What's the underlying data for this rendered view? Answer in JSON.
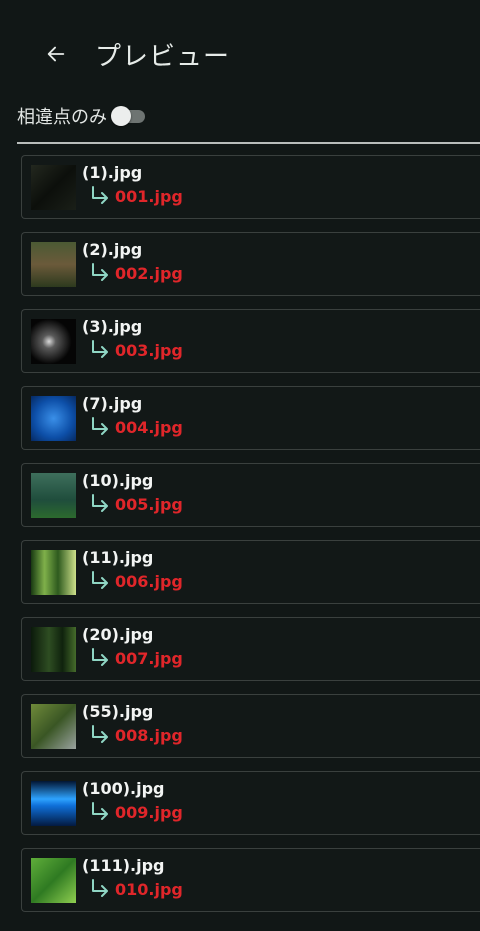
{
  "header": {
    "title": "プレビュー",
    "back_icon": "arrow-left-icon"
  },
  "filter": {
    "label": "相違点のみ",
    "enabled": false
  },
  "colors": {
    "background": "#111716",
    "renamed_text": "#e0262a",
    "arrow": "#8fd6c4"
  },
  "items": [
    {
      "original": "(1).jpg",
      "renamed": "001.jpg",
      "thumb": "dark-forest-photo"
    },
    {
      "original": "(2).jpg",
      "renamed": "002.jpg",
      "thumb": "forest-path-photo"
    },
    {
      "original": "(3).jpg",
      "renamed": "003.jpg",
      "thumb": "dark-flower-photo"
    },
    {
      "original": "(7).jpg",
      "renamed": "004.jpg",
      "thumb": "blue-bokeh-photo"
    },
    {
      "original": "(10).jpg",
      "renamed": "005.jpg",
      "thumb": "misty-green-forest-photo"
    },
    {
      "original": "(11).jpg",
      "renamed": "006.jpg",
      "thumb": "bamboo-photo"
    },
    {
      "original": "(20).jpg",
      "renamed": "007.jpg",
      "thumb": "dark-bamboo-photo"
    },
    {
      "original": "(55).jpg",
      "renamed": "008.jpg",
      "thumb": "waterfall-garden-photo"
    },
    {
      "original": "(100).jpg",
      "renamed": "009.jpg",
      "thumb": "blue-light-streaks-photo"
    },
    {
      "original": "(111).jpg",
      "renamed": "010.jpg",
      "thumb": "green-lantern-garden-photo"
    }
  ]
}
